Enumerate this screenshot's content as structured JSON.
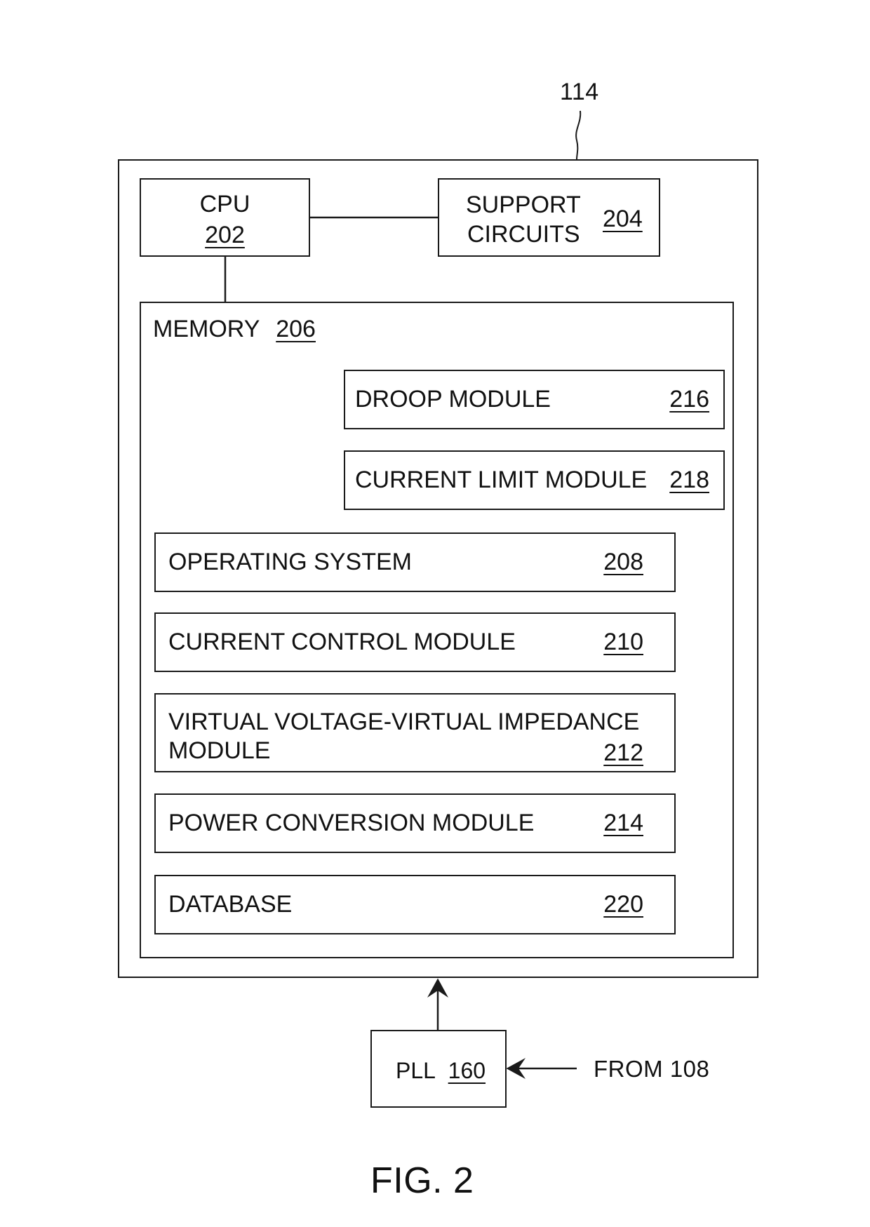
{
  "figure": {
    "caption": "FIG. 2",
    "system_ref": "114"
  },
  "cpu": {
    "label": "CPU",
    "ref": "202"
  },
  "support": {
    "line1": "SUPPORT",
    "line2": "CIRCUITS",
    "ref": "204"
  },
  "memory": {
    "label": "MEMORY",
    "ref": "206"
  },
  "modules": {
    "droop": {
      "label": "DROOP MODULE",
      "ref": "216"
    },
    "current_limit": {
      "label": "CURRENT LIMIT MODULE",
      "ref": "218"
    },
    "operating_system": {
      "label": "OPERATING SYSTEM",
      "ref": "208"
    },
    "current_control": {
      "label": "CURRENT CONTROL MODULE",
      "ref": "210"
    },
    "virtual_impedance": {
      "line1": "VIRTUAL VOLTAGE-VIRTUAL IMPEDANCE",
      "line2": "MODULE",
      "ref": "212"
    },
    "power_conversion": {
      "label": "POWER CONVERSION MODULE",
      "ref": "214"
    },
    "database": {
      "label": "DATABASE",
      "ref": "220"
    }
  },
  "pll": {
    "label": "PLL",
    "ref": "160"
  },
  "input": {
    "label": "FROM 108"
  }
}
